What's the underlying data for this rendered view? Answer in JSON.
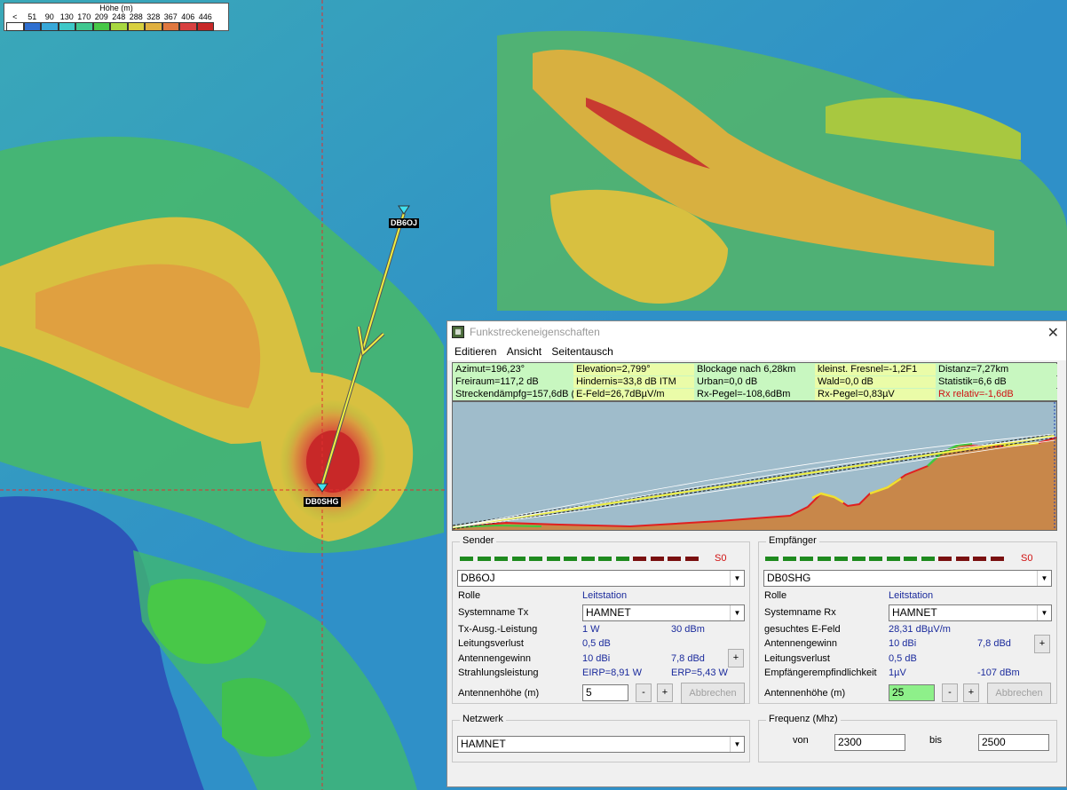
{
  "map": {
    "legend_title": "Höhe (m)",
    "legend_values": [
      "<",
      "51",
      "90",
      "130",
      "170",
      "209",
      "248",
      "288",
      "328",
      "367",
      "406",
      "446"
    ],
    "legend_colors": [
      "#ffffff",
      "#2f6fd0",
      "#38a8d8",
      "#3ec8c8",
      "#40c890",
      "#48c848",
      "#a8d840",
      "#d8d040",
      "#e0b040",
      "#e07840",
      "#d84040",
      "#c82828"
    ],
    "station_tx": "DB6OJ",
    "station_rx": "DB0SHG"
  },
  "window": {
    "title": "Funkstreckeneigenschaften",
    "close": "✕",
    "icon": "network-icon"
  },
  "menu": [
    "Editieren",
    "Ansicht",
    "Seitentausch"
  ],
  "stats": {
    "row1": [
      "Azimut=196,23°",
      "Elevation=2,799°",
      "Blockage nach 6,28km",
      "kleinst. Fresnel=-1,2F1",
      "Distanz=7,27km"
    ],
    "row2": [
      "Freiraum=117,2 dB",
      "Hindernis=33,8 dB ITM",
      "Urban=0,0 dB",
      "Wald=0,0 dB",
      "Statistik=6,6 dB"
    ],
    "row3": [
      "Streckendämpfg=157,6dB (3",
      "E-Feld=26,7dBµV/m",
      "Rx-Pegel=-108,6dBm",
      "Rx-Pegel=0,83µV",
      "Rx relativ=-1,6dB"
    ]
  },
  "sender": {
    "legend": "Sender",
    "meter_label": "S0",
    "station": "DB6OJ",
    "rolle_label": "Rolle",
    "rolle_value": "Leitstation",
    "system_label": "Systemname Tx",
    "system_value": "HAMNET",
    "power_label": "Tx-Ausg.-Leistung",
    "power_w": "1 W",
    "power_dbm": "30 dBm",
    "loss_label": "Leitungsverlust",
    "loss_value": "0,5 dB",
    "gain_label": "Antennengewinn",
    "gain_dbi": "10 dBi",
    "gain_dbd": "7,8 dBd",
    "rad_label": "Strahlungsleistung",
    "eirp": "EIRP=8,91 W",
    "erp": "ERP=5,43 W",
    "height_label": "Antennenhöhe (m)",
    "height_value": "5",
    "minus": "-",
    "plus": "+",
    "cancel": "Abbrechen"
  },
  "empfaenger": {
    "legend": "Empfänger",
    "meter_label": "S0",
    "station": "DB0SHG",
    "rolle_label": "Rolle",
    "rolle_value": "Leitstation",
    "system_label": "Systemname Rx",
    "system_value": "HAMNET",
    "efield_label": "gesuchtes E-Feld",
    "efield_value": "28,31 dBµV/m",
    "gain_label": "Antennengewinn",
    "gain_dbi": "10 dBi",
    "gain_dbd": "7,8 dBd",
    "loss_label": "Leitungsverlust",
    "loss_value": "0,5 dB",
    "sens_label": "Empfängerempfindlichkeit",
    "sens_uv": "1µV",
    "sens_dbm": "-107 dBm",
    "height_label": "Antennenhöhe (m)",
    "height_value": "25",
    "minus": "-",
    "plus": "+",
    "cancel": "Abbrechen"
  },
  "netzwerk": {
    "legend": "Netzwerk",
    "value": "HAMNET"
  },
  "frequenz": {
    "legend": "Frequenz (Mhz)",
    "von_label": "von",
    "von": "2300",
    "bis_label": "bis",
    "bis": "2500"
  },
  "colors": {
    "stats_green": "#c8f7c0",
    "stats_yellow": "#eafca8",
    "warning_red": "#d01010",
    "link_label_blue": "#1a2a9c"
  }
}
